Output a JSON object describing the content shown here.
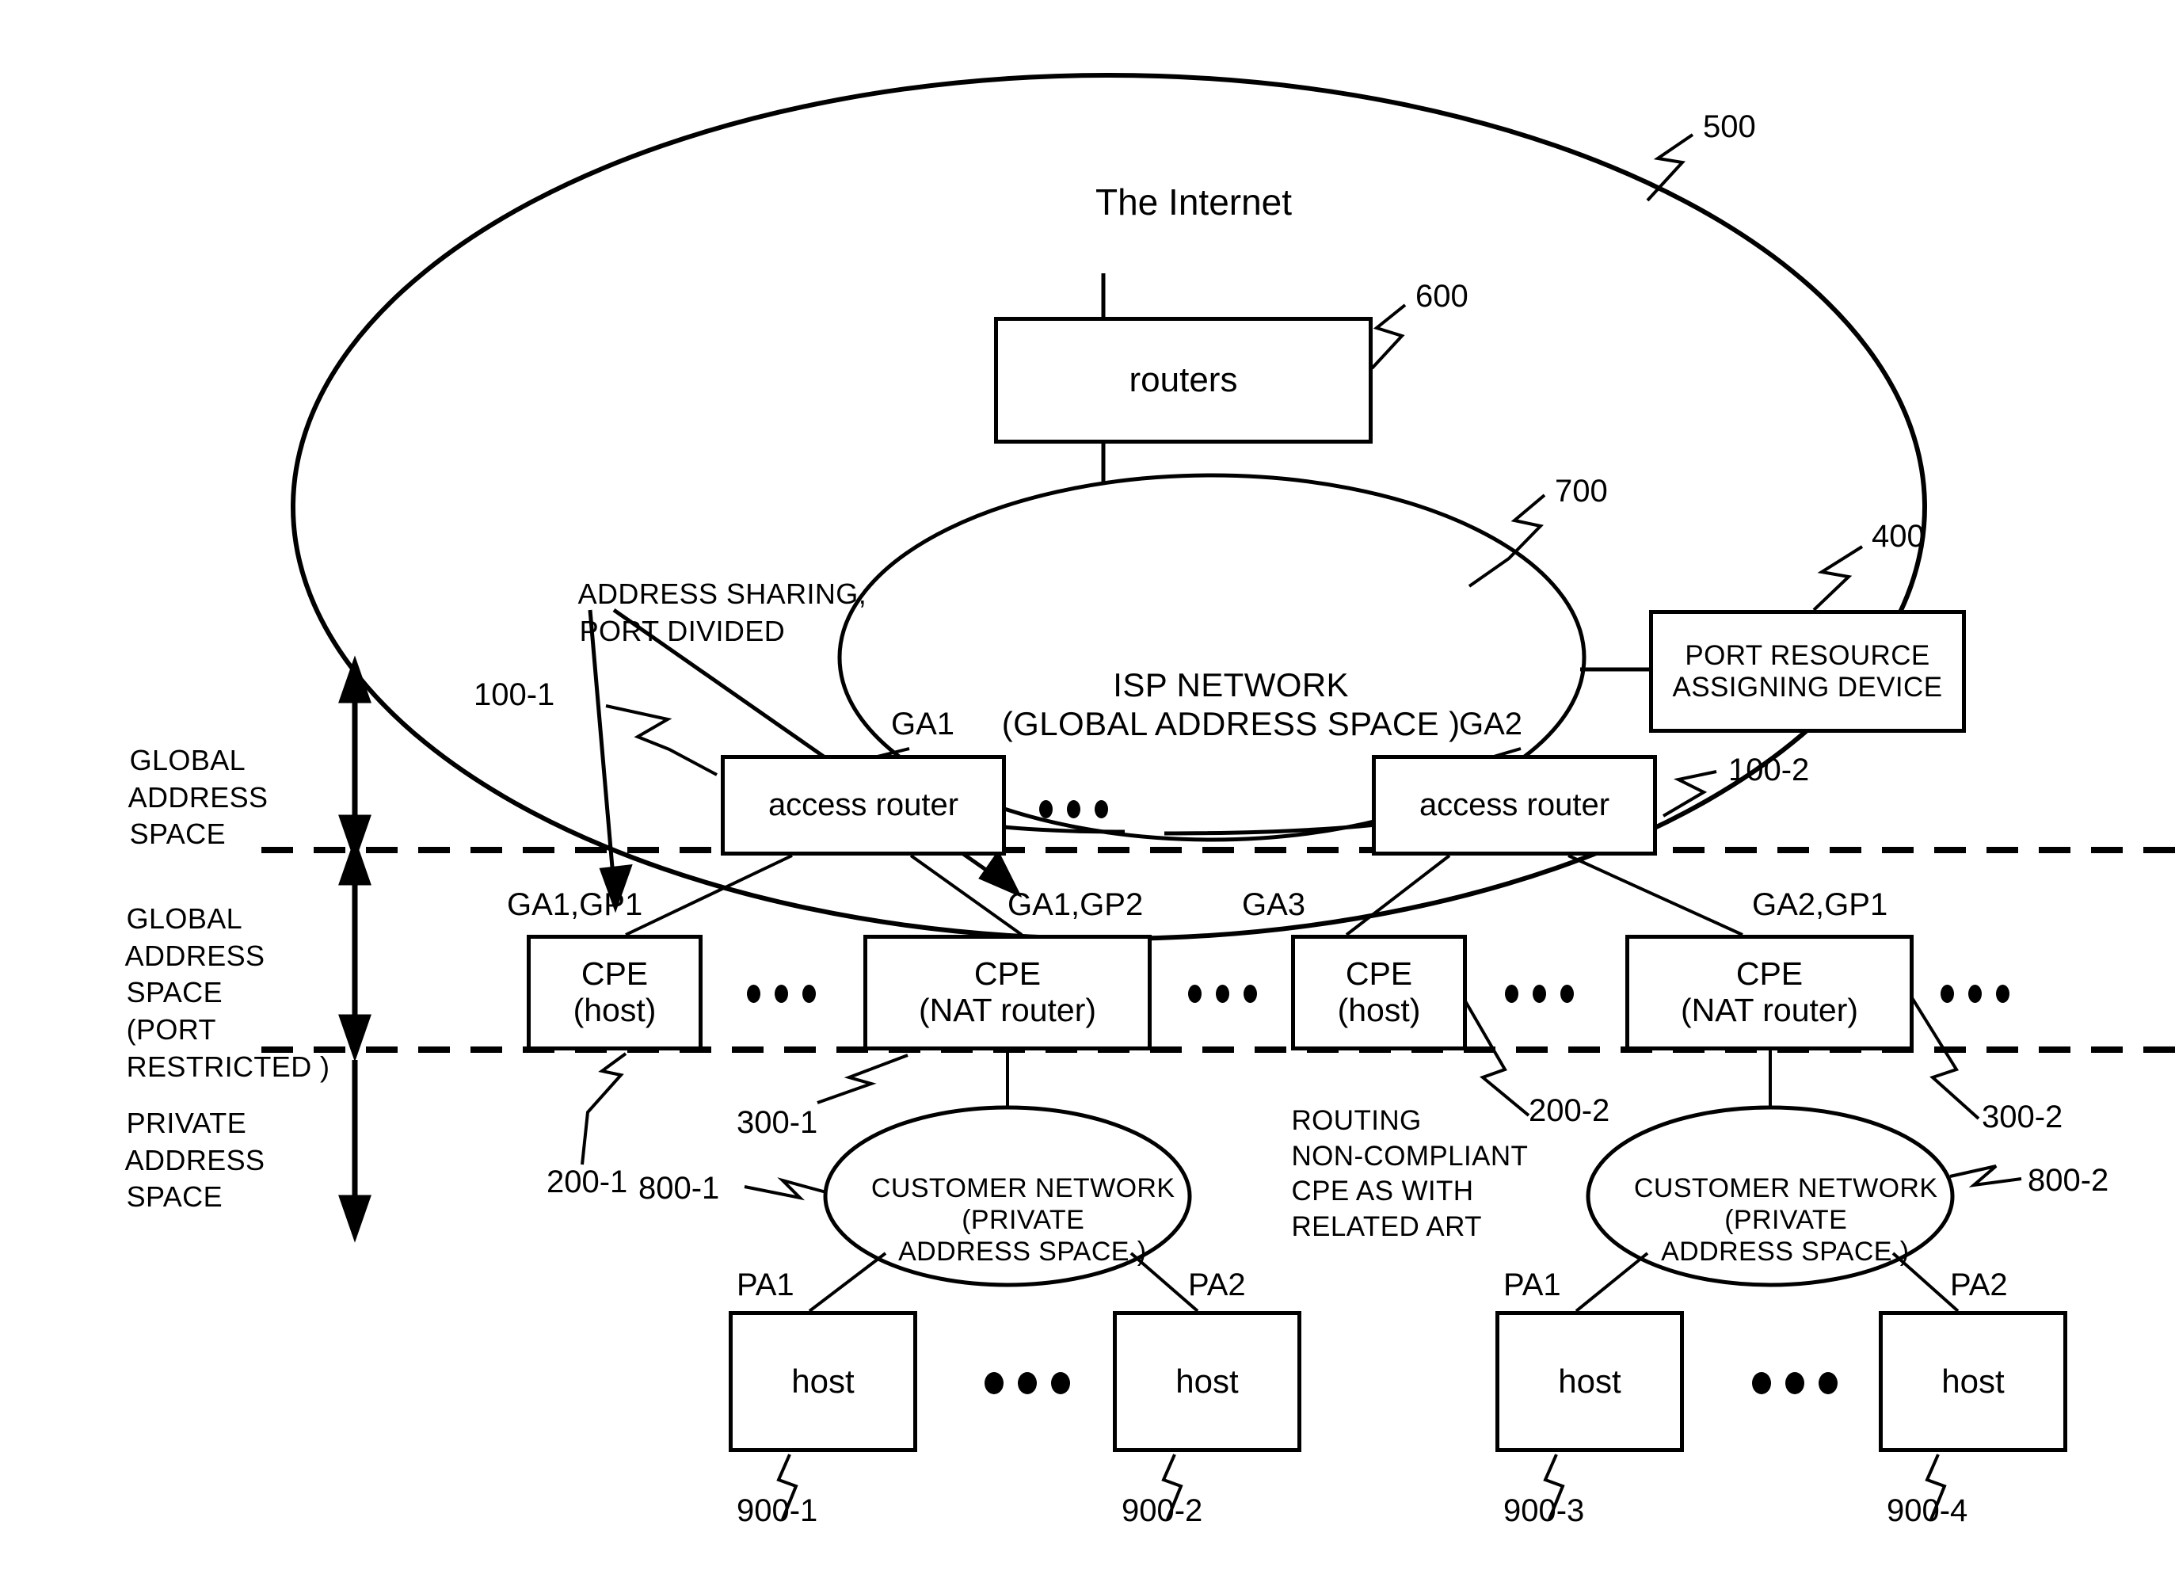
{
  "figure": {
    "internet_label": "The Internet",
    "internet_ref": "500",
    "routers_label": "routers",
    "routers_ref": "600",
    "isp_network": {
      "line1": "ISP NETWORK",
      "line2": "(GLOBAL ADDRESS SPACE )",
      "ref": "700"
    },
    "port_resource_device": {
      "line1": "PORT RESOURCE",
      "line2": "ASSIGNING DEVICE",
      "ref": "400"
    },
    "annotation_address_sharing": {
      "line1": "ADDRESS SHARING,",
      "line2": "PORT DIVIDED"
    },
    "annotation_routing_noncompliant": {
      "line1": "ROUTING",
      "line2": "NON-COMPLIANT",
      "line3": "CPE AS WITH",
      "line4": "RELATED ART"
    },
    "zones": [
      {
        "name": "zone-global-address-space",
        "lines": [
          "GLOBAL",
          "ADDRESS",
          "SPACE"
        ]
      },
      {
        "name": "zone-global-address-space-port-restricted",
        "lines": [
          "GLOBAL",
          "ADDRESS",
          "SPACE",
          "(PORT",
          "RESTRICTED )"
        ]
      },
      {
        "name": "zone-private-address-space",
        "lines": [
          "PRIVATE",
          "ADDRESS",
          "SPACE"
        ]
      }
    ],
    "access_routers": [
      {
        "label": "access router",
        "ref": "100-1",
        "address": "GA1"
      },
      {
        "label": "access router",
        "ref": "100-2",
        "address": "GA2"
      }
    ],
    "cpes": [
      {
        "line1": "CPE",
        "line2": "(host)",
        "ref": "200-1",
        "address": "GA1,GP1"
      },
      {
        "line1": "CPE",
        "line2": "(NAT router)",
        "ref": "300-1",
        "address": "GA1,GP2"
      },
      {
        "line1": "CPE",
        "line2": "(host)",
        "ref": "200-2",
        "address": "GA3"
      },
      {
        "line1": "CPE",
        "line2": "(NAT router)",
        "ref": "300-2",
        "address": "GA2,GP1"
      }
    ],
    "customer_networks": [
      {
        "line1": "CUSTOMER NETWORK",
        "line2": "(PRIVATE",
        "line3": "ADDRESS SPACE )",
        "ref": "800-1"
      },
      {
        "line1": "CUSTOMER NETWORK",
        "line2": "(PRIVATE",
        "line3": "ADDRESS SPACE )",
        "ref": "800-2"
      }
    ],
    "hosts": [
      {
        "label": "host",
        "ref": "900-1",
        "address": "PA1"
      },
      {
        "label": "host",
        "ref": "900-2",
        "address": "PA2"
      },
      {
        "label": "host",
        "ref": "900-3",
        "address": "PA1"
      },
      {
        "label": "host",
        "ref": "900-4",
        "address": "PA2"
      }
    ],
    "colors": {
      "ink": "#000000",
      "paper": "#ffffff"
    }
  }
}
